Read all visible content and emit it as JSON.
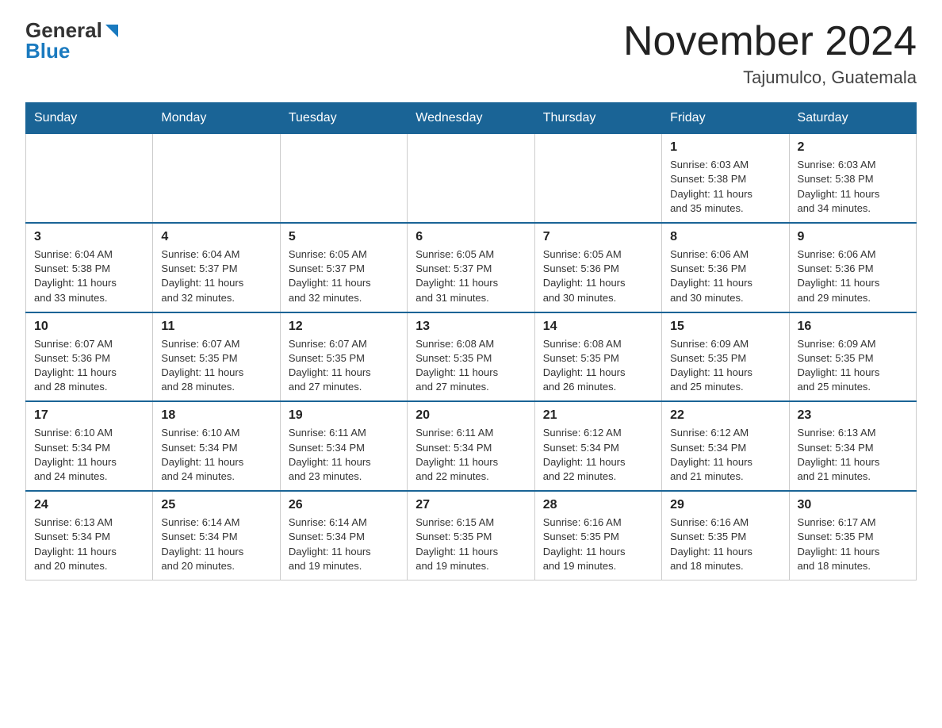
{
  "header": {
    "logo_general": "General",
    "logo_blue": "Blue",
    "title": "November 2024",
    "subtitle": "Tajumulco, Guatemala"
  },
  "weekdays": [
    "Sunday",
    "Monday",
    "Tuesday",
    "Wednesday",
    "Thursday",
    "Friday",
    "Saturday"
  ],
  "weeks": [
    [
      {
        "day": "",
        "info": ""
      },
      {
        "day": "",
        "info": ""
      },
      {
        "day": "",
        "info": ""
      },
      {
        "day": "",
        "info": ""
      },
      {
        "day": "",
        "info": ""
      },
      {
        "day": "1",
        "info": "Sunrise: 6:03 AM\nSunset: 5:38 PM\nDaylight: 11 hours\nand 35 minutes."
      },
      {
        "day": "2",
        "info": "Sunrise: 6:03 AM\nSunset: 5:38 PM\nDaylight: 11 hours\nand 34 minutes."
      }
    ],
    [
      {
        "day": "3",
        "info": "Sunrise: 6:04 AM\nSunset: 5:38 PM\nDaylight: 11 hours\nand 33 minutes."
      },
      {
        "day": "4",
        "info": "Sunrise: 6:04 AM\nSunset: 5:37 PM\nDaylight: 11 hours\nand 32 minutes."
      },
      {
        "day": "5",
        "info": "Sunrise: 6:05 AM\nSunset: 5:37 PM\nDaylight: 11 hours\nand 32 minutes."
      },
      {
        "day": "6",
        "info": "Sunrise: 6:05 AM\nSunset: 5:37 PM\nDaylight: 11 hours\nand 31 minutes."
      },
      {
        "day": "7",
        "info": "Sunrise: 6:05 AM\nSunset: 5:36 PM\nDaylight: 11 hours\nand 30 minutes."
      },
      {
        "day": "8",
        "info": "Sunrise: 6:06 AM\nSunset: 5:36 PM\nDaylight: 11 hours\nand 30 minutes."
      },
      {
        "day": "9",
        "info": "Sunrise: 6:06 AM\nSunset: 5:36 PM\nDaylight: 11 hours\nand 29 minutes."
      }
    ],
    [
      {
        "day": "10",
        "info": "Sunrise: 6:07 AM\nSunset: 5:36 PM\nDaylight: 11 hours\nand 28 minutes."
      },
      {
        "day": "11",
        "info": "Sunrise: 6:07 AM\nSunset: 5:35 PM\nDaylight: 11 hours\nand 28 minutes."
      },
      {
        "day": "12",
        "info": "Sunrise: 6:07 AM\nSunset: 5:35 PM\nDaylight: 11 hours\nand 27 minutes."
      },
      {
        "day": "13",
        "info": "Sunrise: 6:08 AM\nSunset: 5:35 PM\nDaylight: 11 hours\nand 27 minutes."
      },
      {
        "day": "14",
        "info": "Sunrise: 6:08 AM\nSunset: 5:35 PM\nDaylight: 11 hours\nand 26 minutes."
      },
      {
        "day": "15",
        "info": "Sunrise: 6:09 AM\nSunset: 5:35 PM\nDaylight: 11 hours\nand 25 minutes."
      },
      {
        "day": "16",
        "info": "Sunrise: 6:09 AM\nSunset: 5:35 PM\nDaylight: 11 hours\nand 25 minutes."
      }
    ],
    [
      {
        "day": "17",
        "info": "Sunrise: 6:10 AM\nSunset: 5:34 PM\nDaylight: 11 hours\nand 24 minutes."
      },
      {
        "day": "18",
        "info": "Sunrise: 6:10 AM\nSunset: 5:34 PM\nDaylight: 11 hours\nand 24 minutes."
      },
      {
        "day": "19",
        "info": "Sunrise: 6:11 AM\nSunset: 5:34 PM\nDaylight: 11 hours\nand 23 minutes."
      },
      {
        "day": "20",
        "info": "Sunrise: 6:11 AM\nSunset: 5:34 PM\nDaylight: 11 hours\nand 22 minutes."
      },
      {
        "day": "21",
        "info": "Sunrise: 6:12 AM\nSunset: 5:34 PM\nDaylight: 11 hours\nand 22 minutes."
      },
      {
        "day": "22",
        "info": "Sunrise: 6:12 AM\nSunset: 5:34 PM\nDaylight: 11 hours\nand 21 minutes."
      },
      {
        "day": "23",
        "info": "Sunrise: 6:13 AM\nSunset: 5:34 PM\nDaylight: 11 hours\nand 21 minutes."
      }
    ],
    [
      {
        "day": "24",
        "info": "Sunrise: 6:13 AM\nSunset: 5:34 PM\nDaylight: 11 hours\nand 20 minutes."
      },
      {
        "day": "25",
        "info": "Sunrise: 6:14 AM\nSunset: 5:34 PM\nDaylight: 11 hours\nand 20 minutes."
      },
      {
        "day": "26",
        "info": "Sunrise: 6:14 AM\nSunset: 5:34 PM\nDaylight: 11 hours\nand 19 minutes."
      },
      {
        "day": "27",
        "info": "Sunrise: 6:15 AM\nSunset: 5:35 PM\nDaylight: 11 hours\nand 19 minutes."
      },
      {
        "day": "28",
        "info": "Sunrise: 6:16 AM\nSunset: 5:35 PM\nDaylight: 11 hours\nand 19 minutes."
      },
      {
        "day": "29",
        "info": "Sunrise: 6:16 AM\nSunset: 5:35 PM\nDaylight: 11 hours\nand 18 minutes."
      },
      {
        "day": "30",
        "info": "Sunrise: 6:17 AM\nSunset: 5:35 PM\nDaylight: 11 hours\nand 18 minutes."
      }
    ]
  ]
}
